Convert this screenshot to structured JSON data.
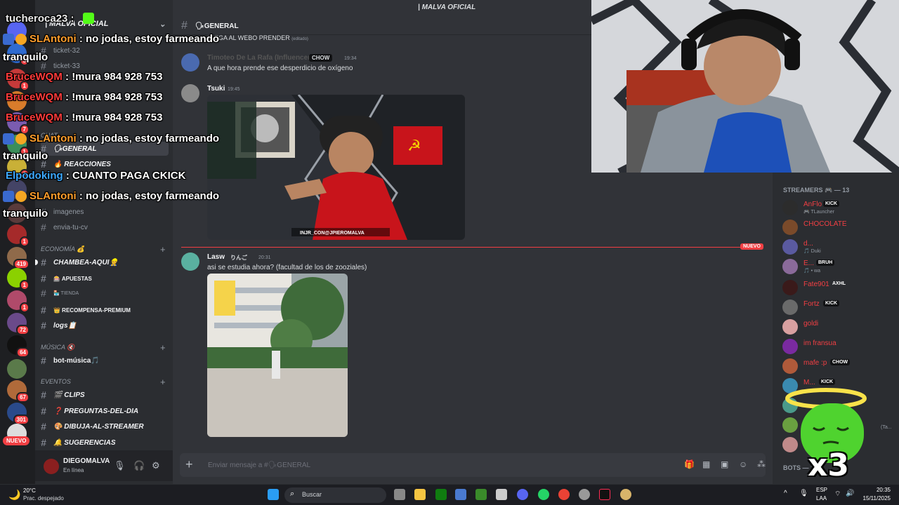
{
  "window": {
    "title": "| MALVA OFICIAL"
  },
  "rail": {
    "badges": [
      "5",
      "1",
      "7",
      "1",
      "2",
      "1",
      "419",
      "1",
      "1",
      "72",
      "64",
      "67",
      "301"
    ],
    "new_label": "NUEVO"
  },
  "sidebar": {
    "guild_name": "| MALVA OFICIAL",
    "channels_top": [
      "ticket-32",
      "ticket-33"
    ],
    "categories": {
      "chat": "CHAT",
      "economia": "ECONOMÍA 💰",
      "musica": "MÚSICA 🔇",
      "eventos": "EVENTOS"
    },
    "channels": {
      "general": "🗣GENERAL",
      "reacciones": "🔥 REACCIONES",
      "imagenes": "imagenes",
      "envia_tu_cv": "envia-tu-cv",
      "chambea": "CHAMBEA-AQUI👷",
      "apuestas": "🎰 APUESTAS",
      "tienda": "🏪 TIENDA",
      "recompensa": "👑 RECOMPENSA-PREMIUM",
      "logs": "logs📋",
      "bot_musica": "bot-música🎵",
      "clips": "🎬 CLIPS",
      "preguntas": "❓ PREGUNTAS-DEL-DIA",
      "dibuja": "🎨 DIBUJA-AL-STREAMER",
      "sugerencias": "🔔 SUGERENCIAS"
    },
    "user": {
      "name": "DIEGOMALVA",
      "status": "En línea"
    }
  },
  "chat": {
    "channel_title": "🗣GENERAL",
    "truncated_top": "LLEGA AL WEBO PRENDER",
    "truncated_edited": "(editado)",
    "messages": [
      {
        "author": "Timoteo De La Rafa (Influencer)",
        "tag": "CHOW",
        "time": "19:34",
        "text": "A que hora prende ese desperdicio de oxígeno"
      },
      {
        "author": "Tsuki",
        "time": "19:45",
        "image_caption": "INJR_CON@JPIEROMALVA"
      },
      {
        "author": "Lasw",
        "tag": "りんご",
        "time": "20:31",
        "text": "asi se estudia ahora? (facultad de los de zooziales)"
      }
    ],
    "new_divider": "NUEVO",
    "composer_placeholder": "Enviar mensaje a #🗣GENERAL"
  },
  "overlay": {
    "lines": [
      {
        "user": "tucheroca23",
        "sep": " : ",
        "text": ""
      },
      {
        "user": "SLAntoni",
        "sep": " : ",
        "text": "no jodas, estoy farmeando"
      },
      {
        "user": "",
        "sep": "",
        "text": "tranquilo"
      },
      {
        "user": "BruceWQM",
        "sep": " : ",
        "text": "!mura 984 928 753"
      },
      {
        "user": "BruceWQM",
        "sep": " : ",
        "text": "!mura 984 928 753"
      },
      {
        "user": "BruceWQM",
        "sep": " : ",
        "text": "!mura 984 928 753"
      },
      {
        "user": "SLAntoni",
        "sep": " : ",
        "text": "no jodas, estoy farmeando"
      },
      {
        "user": "",
        "sep": "",
        "text": "tranquilo"
      },
      {
        "user": "Elpodoking",
        "sep": " : ",
        "text": "CUANTO PAGA CKICK"
      },
      {
        "user": "SLAntoni",
        "sep": " : ",
        "text": "no jodas, estoy farmeando"
      },
      {
        "user": "",
        "sep": "",
        "text": "tranquilo"
      }
    ]
  },
  "members": {
    "header": "STREAMERS 🎮 — 13",
    "list": [
      {
        "name": "AnFlo",
        "tag": "KICK",
        "sub": "🎮 TLauncher"
      },
      {
        "name": "CHOCOLATE",
        "tag": "",
        "sub": ""
      },
      {
        "name": "d...",
        "tag": "",
        "sub": "🎵 Duki"
      },
      {
        "name": "E...",
        "tag": "BRUH",
        "sub": "🎵 • wa"
      },
      {
        "name": "Fate901",
        "tag": "AXHL",
        "sub": ""
      },
      {
        "name": "Fortz",
        "tag": "KICK",
        "sub": ""
      },
      {
        "name": "goldi",
        "tag": "",
        "sub": ""
      },
      {
        "name": "im fransua",
        "tag": "",
        "sub": ""
      },
      {
        "name": "mafe :p",
        "tag": "CHOW",
        "sub": ""
      },
      {
        "name": "M...",
        "tag": "KICK",
        "sub": ""
      }
    ],
    "bots_header": "BOTS — 1",
    "member_extra": "(Ta..."
  },
  "mascot": {
    "multiplier": "x3"
  },
  "taskbar": {
    "weather_temp": "20°C",
    "weather_desc": "Prac. despejado",
    "search_label": "Buscar",
    "lang1": "ESP",
    "lang2": "LAA",
    "time": "20:35",
    "date": "15/11/2025"
  },
  "colors": {
    "accent_red": "#f23f43",
    "kick_green": "#53fc18",
    "discord_bg": "#313338"
  }
}
